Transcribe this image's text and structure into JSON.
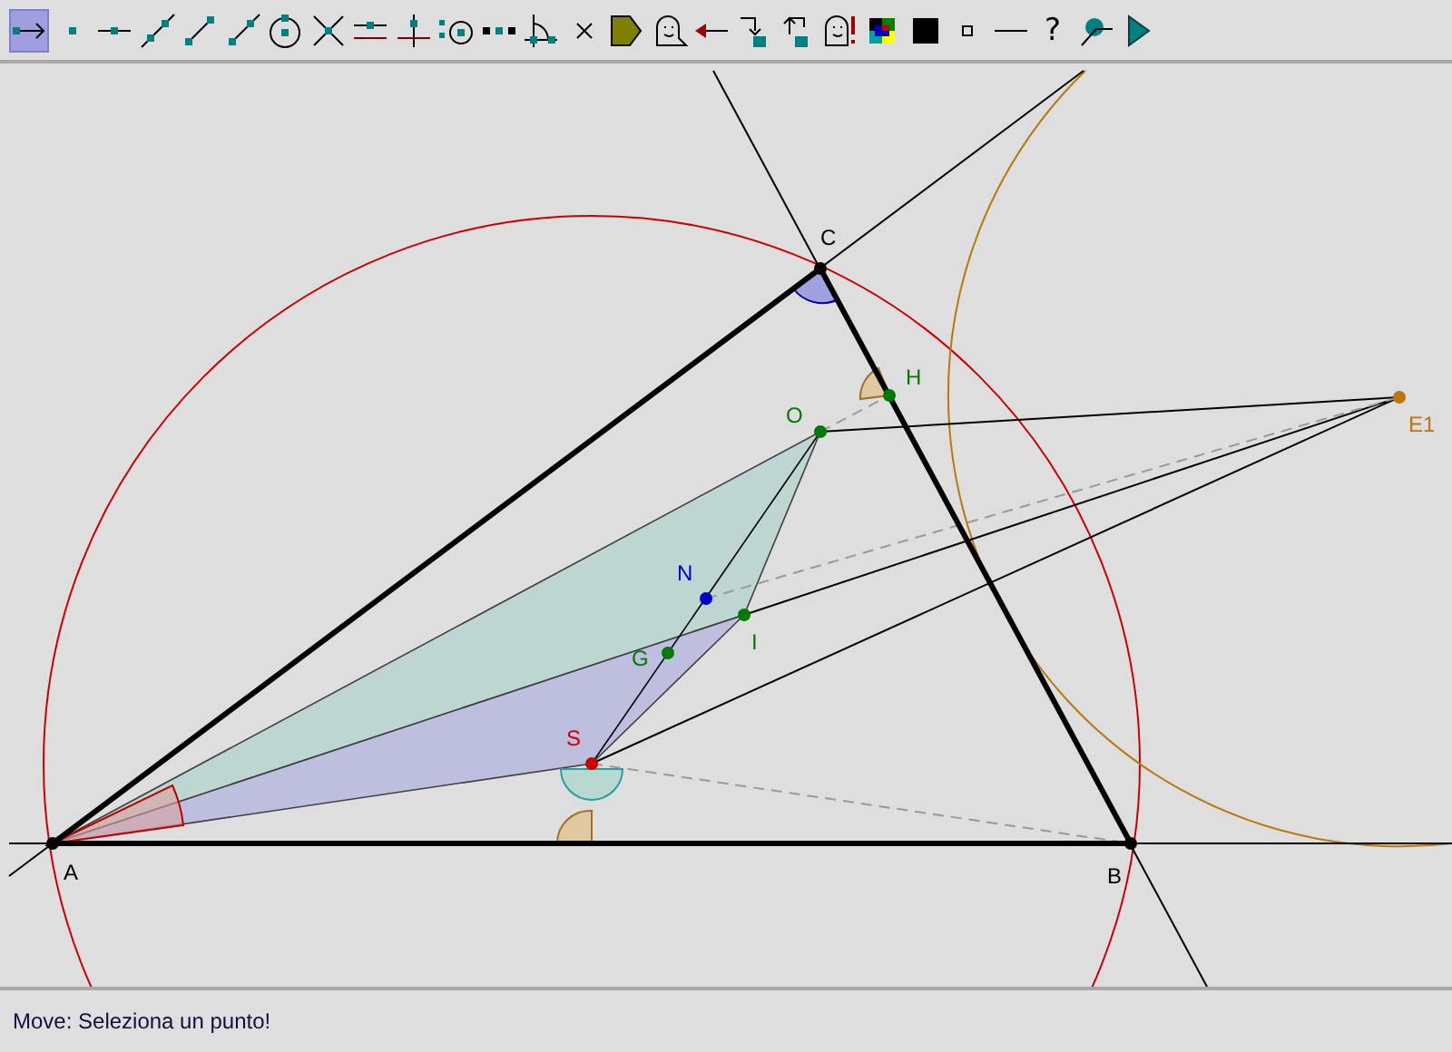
{
  "toolbar": {
    "tools": [
      {
        "kind": "move",
        "selected": true
      },
      {
        "kind": "point",
        "selected": false
      },
      {
        "kind": "segment",
        "selected": false
      },
      {
        "kind": "line",
        "selected": false
      },
      {
        "kind": "vector",
        "selected": false
      },
      {
        "kind": "ray",
        "selected": false
      },
      {
        "kind": "circle",
        "selected": false
      },
      {
        "kind": "intersect",
        "selected": false
      },
      {
        "kind": "parallel",
        "selected": false
      },
      {
        "kind": "perpendicular",
        "selected": false
      },
      {
        "kind": "midpoint",
        "selected": false
      },
      {
        "kind": "points",
        "selected": false
      },
      {
        "kind": "angle",
        "selected": false
      },
      {
        "kind": "cross",
        "selected": false
      },
      {
        "kind": "polygon",
        "selected": false
      },
      {
        "kind": "ghost",
        "selected": false
      },
      {
        "kind": "back",
        "selected": false
      },
      {
        "kind": "undo",
        "selected": false
      },
      {
        "kind": "redo",
        "selected": false
      },
      {
        "kind": "ghostalert",
        "selected": false
      },
      {
        "kind": "colors",
        "selected": false
      },
      {
        "kind": "fillsquare",
        "selected": false
      },
      {
        "kind": "smallsquare",
        "selected": false
      },
      {
        "kind": "dash",
        "selected": false
      },
      {
        "kind": "help",
        "selected": false,
        "glyph": "?"
      },
      {
        "kind": "locus",
        "selected": false
      },
      {
        "kind": "play",
        "selected": false
      }
    ]
  },
  "canvas": {
    "points": [
      {
        "label": "A",
        "color": "#000000"
      },
      {
        "label": "B",
        "color": "#000000"
      },
      {
        "label": "C",
        "color": "#000000"
      },
      {
        "label": "O",
        "color": "#007a00"
      },
      {
        "label": "H",
        "color": "#007a00"
      },
      {
        "label": "N",
        "color": "#0000cc"
      },
      {
        "label": "I",
        "color": "#007a00"
      },
      {
        "label": "G",
        "color": "#007a00"
      },
      {
        "label": "S",
        "color": "#cc0000"
      },
      {
        "label": "E1",
        "color": "#b8780a"
      }
    ]
  },
  "status_bar": {
    "message": "Move: Seleziona un punto!"
  }
}
